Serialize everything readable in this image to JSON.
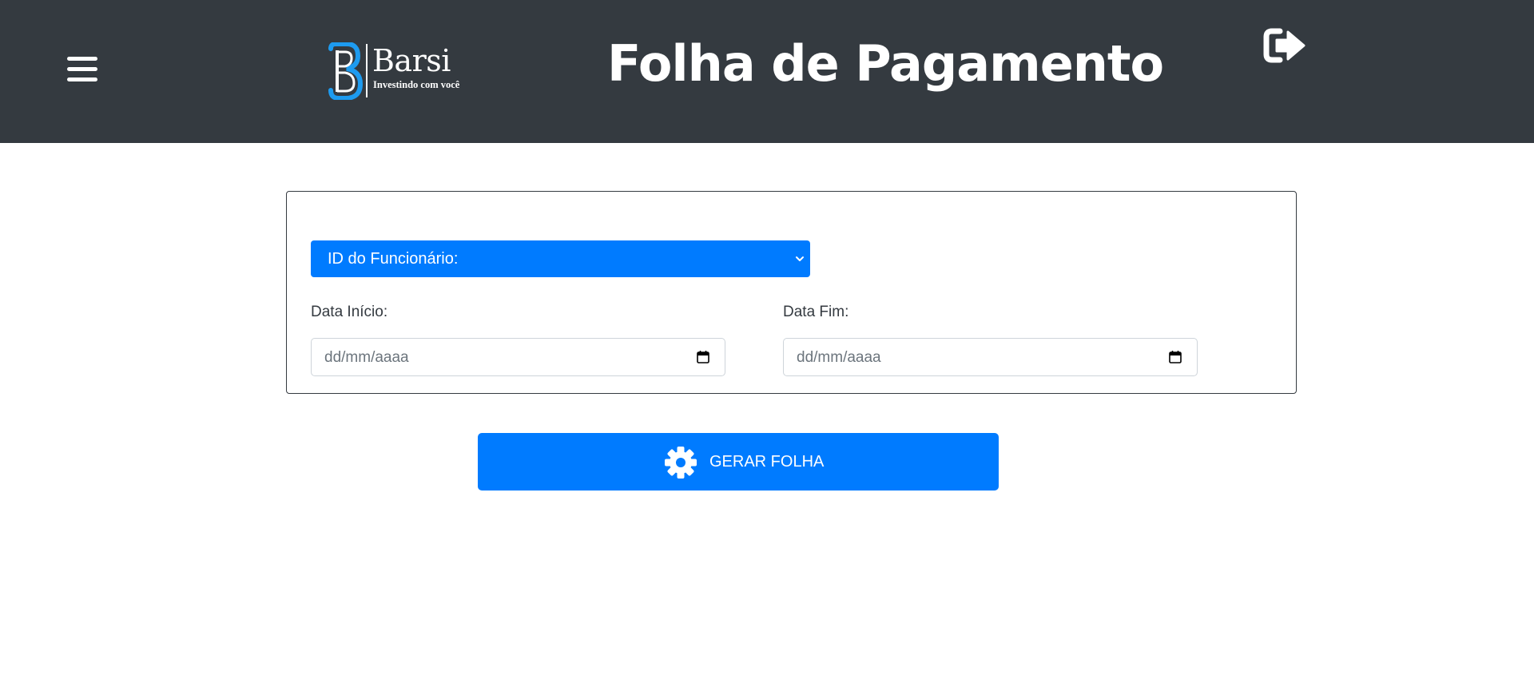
{
  "header": {
    "title": "Folha de Pagamento",
    "logo": {
      "name": "Barsi",
      "tagline": "Investindo com você",
      "accent_color": "#1d9bf0"
    },
    "menu_icon": "hamburger-menu-icon",
    "logout_icon": "sign-out-icon",
    "background_color": "#343a40"
  },
  "form": {
    "employee_select": {
      "selected": "ID do Funcionário:",
      "icon": "chevron-down-icon"
    },
    "start_date": {
      "label": "Data Início:",
      "placeholder": "dd/mm/aaaa",
      "icon": "calendar-icon"
    },
    "end_date": {
      "label": "Data Fim:",
      "placeholder": "dd/mm/aaaa",
      "icon": "calendar-icon"
    }
  },
  "actions": {
    "generate": {
      "label": "GERAR FOLHA",
      "icon": "gear-icon",
      "color": "#007bff"
    }
  }
}
